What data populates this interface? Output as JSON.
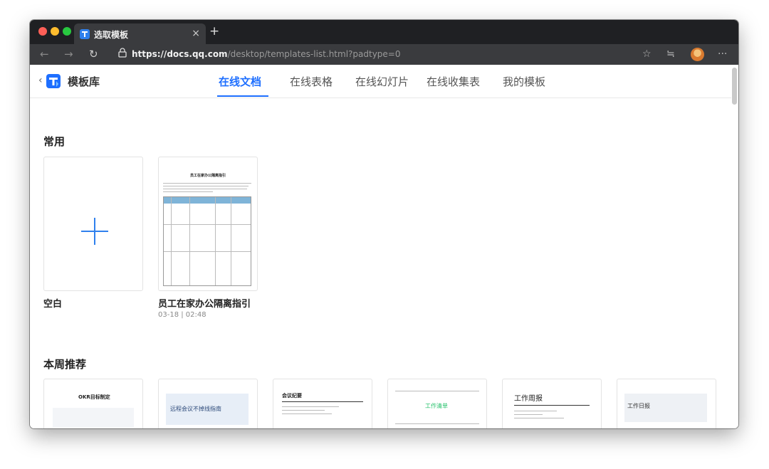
{
  "browser": {
    "tab_title": "选取模板",
    "tab_close": "×",
    "new_tab": "+",
    "url_host": "https://docs.qq.com",
    "url_path": "/desktop/templates-list.html?padtype=0",
    "icons": [
      "back-arrow-icon",
      "forward-arrow-icon",
      "reload-icon",
      "lock-icon",
      "star-icon",
      "collections-icon",
      "profile-avatar",
      "more-icon"
    ]
  },
  "header": {
    "back_symbol": "‹",
    "title": "模板库",
    "tabs": [
      {
        "label": "在线文档",
        "active": true
      },
      {
        "label": "在线表格",
        "active": false
      },
      {
        "label": "在线幻灯片",
        "active": false
      },
      {
        "label": "在线收集表",
        "active": false
      },
      {
        "label": "我的模板",
        "active": false
      }
    ]
  },
  "common": {
    "title": "常用",
    "blank_label": "空白",
    "recent": {
      "name": "员工在家办公隔离指引",
      "meta": "03-18 | 02:48",
      "thumb_title": "员工在家办公隔离指引"
    }
  },
  "weekly": {
    "title": "本周推荐",
    "templates": [
      {
        "thumb_text": "OKR目标制定"
      },
      {
        "thumb_text": "远程会议不掉线指南"
      },
      {
        "thumb_text": "会议纪要"
      },
      {
        "thumb_text": "工作清单"
      },
      {
        "thumb_text": "工作周报"
      },
      {
        "thumb_text": "工作日报"
      }
    ]
  },
  "colors": {
    "accent": "#1e6fff",
    "plus": "#2f80ed",
    "titlebar": "#1f2023",
    "addressbar": "#3a3b3e",
    "green_accent": "#27c26c"
  }
}
